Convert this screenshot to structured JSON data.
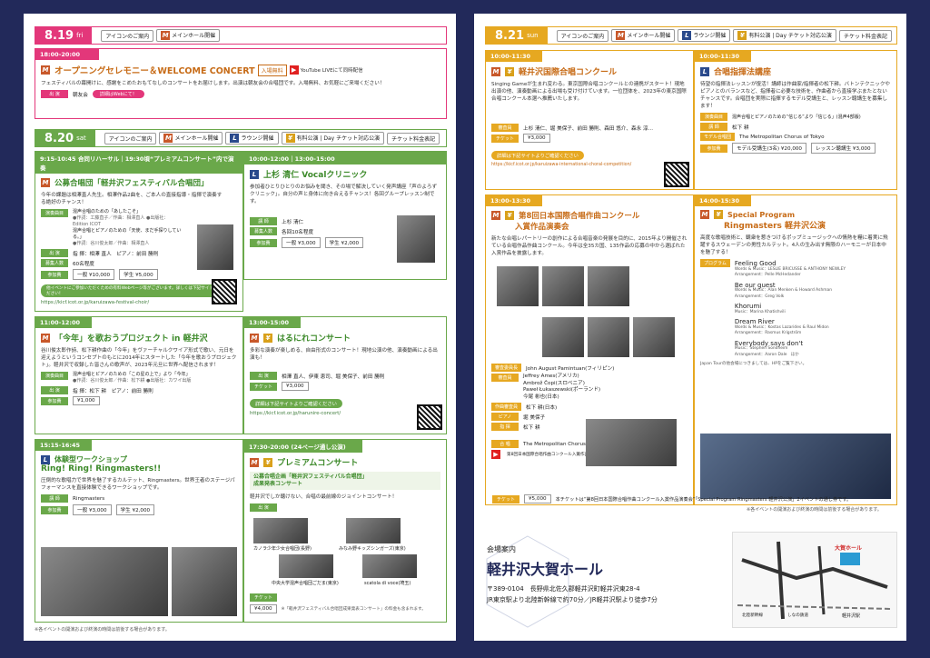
{
  "colors": {
    "pink": "#e3377a",
    "green": "#6aa84a",
    "gold": "#e6a821",
    "navy": "#22295a"
  },
  "legend": {
    "about": "アイコンのご案内",
    "main": "メインホール開催",
    "lounge": "ラウンジ開催",
    "ticket": "有料公演 | Day チケット対応公演",
    "ticketsep": "チケット料金表記"
  },
  "d819": {
    "date": "8.19",
    "dow": "fri",
    "time": "18:00-20:00",
    "title": "オープニングセレモニー＆WELCOME CONCERT",
    "free": "入場無料",
    "yt": "YouTube LIVEにて同時配信",
    "desc": "フェスティバルの幕開けに、感謝をこめたおもてなしのコンサートをお届けします。出演は朝友会の合唱団です。入場無料、お気軽にご来場ください！",
    "perfLabel": "出 演",
    "perf": "朝友会",
    "web": "詳細はWebにて！"
  },
  "d820": {
    "date": "8.20",
    "dow": "sat",
    "c1": {
      "time": "9:15-10:45 合同リハーサル｜19:30頃“プレミアムコンサート”内で演奏",
      "title": "公募合唱団「軽井沢フェスティバル合唱団」",
      "desc": "今年の課題は相澤直人先生。相澤作品2曲を、ご本人の直接指導・指揮で演奏する絶好のチャンス！",
      "songLabel": "演奏曲目",
      "s1": "混声合唱のための「あしたこそ」",
      "s1b": "●作詞：工藤直子／作曲：相澤直人 ●出版社：Edition ICOT",
      "s2": "混声合唱とピアノのための「天使、まだ手探りしている。」",
      "s2b": "●作詞：谷川俊太郎／作曲：相澤直人",
      "condLabel": "出 演",
      "cond": "指 揮：相澤 直人　ピアノ：前田 勝則",
      "capLabel": "募集人数",
      "cap": "60名程度",
      "feeLabel": "参加費",
      "fee1": "一般 ¥10,000",
      "fee2": "学生 ¥5,000",
      "banner": "他イベントにご参加いただくための有料Webページ等がございます。詳しくは下記サイトをご覧ください！",
      "url": "https://kicf.icot.or.jp/karuizawa-festival-choir/"
    },
    "c2": {
      "time": "10:00-12:00｜13:00-15:00",
      "title": "上杉 清仁 Vocalクリニック",
      "desc": "参加者ひとりひとりのお悩みを聞き、その場で解決していく発声講座「声のよろずクリニック」。自分の声と身体に向き合えるチャンス！各回グループレッスン制です。",
      "lecLabel": "講 師",
      "lec": "上杉 清仁",
      "capLabel": "募集人数",
      "cap": "各回10名程度",
      "feeLabel": "参加費",
      "fee1": "一般 ¥3,000",
      "fee2": "学生 ¥2,000"
    },
    "c3": {
      "time": "11:00-12:00",
      "title": "「今年」を歌おうプロジェクト in 軽井沢",
      "desc": "谷川俊太郎作詩、松下耕作曲の「今年」をヴァーチャルクワイア形式で歌い、元日を迎えようというコンセプトのもとに2014年にスタートした「今年を歌おうプロジェクト」。軽井沢で収録した皆さんの歌声が、2023年元旦に世界へ配信されます！",
      "songLabel": "演奏曲目",
      "s1": "混声合唱とピアノのための「この星の上で」より「今年」",
      "s1b": "●作詞：谷川俊太郎／作曲：松下耕 ●出版社：カワイ出版",
      "condLabel": "出 演",
      "cond": "指 揮：松下 耕　ピアノ：前田 勝則",
      "feeLabel": "参加費",
      "fee": "¥1,000"
    },
    "c4": {
      "time": "13:00-15:00",
      "title": "はるにれコンサート",
      "desc": "多彩な演奏が楽しめる、自由形式のコンサート！現地公演の他、演奏動画による出演も！",
      "perfLabel": "出 演",
      "perf": "相澤 直人、伊東 恵司、堀 美保子、前田 勝則",
      "ticketLabel": "チケット",
      "ticket": "¥3,000",
      "banner": "詳細は下記サイトよりご確認ください",
      "url": "https://kicf.icot.or.jp/harunire-concert/"
    },
    "c5": {
      "time": "15:15-16:45",
      "title1": "体験型ワークショップ",
      "title2": "Ring! Ring! Ringmasters!!",
      "desc": "圧倒的な歌唱力で世界を魅了するカルテット、Ringmasters。世界王者のステージパフォーマンスを直接体験できるワークショップです。",
      "lecLabel": "講 師",
      "lec": "Ringmasters",
      "feeLabel": "参加費",
      "fee1": "一般 ¥3,000",
      "fee2": "学生 ¥2,000"
    },
    "c6": {
      "time": "17:30-20:00 (24ページ通し公演)",
      "title": "プレミアムコンサート",
      "sub1": "公募合唱企画「軽井沢フェスティバル合唱団」",
      "sub2": "成果発表コンサート",
      "desc": "軽井沢でしか聴けない、合唱の最前線のジョイントコンサート！",
      "perfLabel": "出 演",
      "p1": "カノラ少年少女合唱団(長野)",
      "p2": "みなみ野キッズシンガーズ(東京)",
      "p3": "中央大学混声合唱団ごだま(東京)",
      "p4": "scatola di voce(埼玉)",
      "ticketLabel": "チケット",
      "ticket": "¥4,000",
      "ticketNote": "※「軽井沢フェスティバル合唱団成果発表コンサート」の料金も含まれます。"
    },
    "footnote": "※各イベントの開演および終演の時間は前後する場合があります。"
  },
  "d821": {
    "date": "8.21",
    "dow": "sun",
    "c1": {
      "time": "10:00-11:30",
      "title": "軽井沢国際合唱コンクール",
      "desc": "Singing Gameが生まれ変わる。東京国際合唱コンクールとの連携がスタート！現地出演の他、演奏動画による出場も受け付けています。一位団体を、2023年の東京国際合唱コンクール本選へ推薦いたします。",
      "judgeLabel": "審査員",
      "judges": "上杉 清仁、堀 美保子、前田 勝則、森田 悠介、森永 淳…",
      "ticketLabel": "チケット",
      "ticket": "¥3,000",
      "banner": "詳細は下記サイトよりご確認ください",
      "url": "https://kicf.icot.or.jp/karuizawa-international-choral-competition/"
    },
    "c2": {
      "time": "10:00-11:30",
      "title": "合唱指揮法講座",
      "desc": "待望の指揮法レッスンが復活！講師は作曲家/指揮者の松下耕。バトンテクニックやピアノとのバランスなど、指揮者に必要な技術を、作曲者から直接学ぶまたとないチャンスです。合唱団を実際に指揮するモデル受講生と、レッスン聴講生を募集します！",
      "songLabel": "演奏曲目",
      "song": "混声合唱とピアノのための“信じる”より「信じる」(混声4部版)",
      "lecLabel": "講 師",
      "lec": "松下 耕",
      "choirLabel": "モデル合唱団",
      "choir": "The Metropolitan Chorus of Tokyo",
      "feeLabel": "参加費",
      "fee1": "モデル受講生(3名) ¥20,000",
      "fee2": "レッスン聴講生 ¥3,000"
    },
    "c3": {
      "time": "13:00-13:30",
      "title1": "第8回日本国際合唱作曲コンクール",
      "title2": "入賞作品演奏会",
      "desc": "新たな合唱レパートリーの創作による合唱音楽の発展を目的に、2015年より開催されている合唱作品作曲コンクール。今年は全35カ国、135作品の応募の中から選ばれた入賞作品を披露します。",
      "judgeLabel": "審査委員長",
      "judgeHead": "John August Pamintuan(フィリピン)",
      "judgesLabel": "審査員",
      "j1": "Jeffrey Ames(アメリカ)",
      "j2": "Ambrož Čopi(スロベニア)",
      "j3": "Paweł Łukaszewski(ポーランド)",
      "j4": "今尾 彬也(日本)",
      "judge2Label": "作曲審査員",
      "j5": "松下 耕(日本)",
      "pianoLabel": "ピアノ",
      "piano": "堀 美保子",
      "condLabel": "指 揮",
      "cond": "松下 耕",
      "choirLabel": "合 唱",
      "choir": "The Metropolitan Chorus of Tokyo",
      "yt": "第8回日本国際合唱作曲コンクール入賞作品演奏会のみ YouTube LIVEにて同時配信",
      "ticketLabel": "チケット",
      "ticket": "¥5,000",
      "ticketNote": "本チケットは“第8回日本国際合唱作曲コンクール入賞作品演奏会”「Special Program Ringmasters 軽井沢公演」2イベントの通し券です。"
    },
    "c4": {
      "time": "14:00-15:30",
      "title1": "Special Program",
      "title2": "Ringmasters 軽井沢公演",
      "desc": "高度な歌唱技術と、観衆を惹きつけるポップミュージックへの情熱を糧に着実に飛躍するスウェーデンの男性カルテット。4人の生み出す無限のハーモニーが日本中を魅了する！",
      "progLabel": "プログラム",
      "songs": [
        {
          "title": "Feeling Good",
          "credit": "Words & Music：LESLIE BRICUSSE & ANTHONY NEWLEY",
          "arr": "Arrangement：Pelle McHedander"
        },
        {
          "title": "Be our guest",
          "credit": "Words & Music：Alan Menken & Howard Ashman",
          "arr": "Arrangement：Greg Volk"
        },
        {
          "title": "Khorumi",
          "credit": "Music：Marina Khatishvili",
          "arr": ""
        },
        {
          "title": "Dream River",
          "credit": "Words & Music：Kostas Lazarides & Raul Midon",
          "arr": "Arrangement：Rasmus Krigström"
        },
        {
          "title": "Everybody says don't",
          "credit": "Music：Stephen Sondheim",
          "arr": "Arrangement：Aaron Dale"
        }
      ],
      "others": "ほか",
      "note": "Japan Tourの他会場につきましては、HPをご覧下さい。"
    },
    "footnote": "※各イベントの開演および終演の時間は前後する場合があります。"
  },
  "venue": {
    "guide": "会場案内",
    "name": "軽井沢大賀ホール",
    "addr": "〒389-0104　長野県北佐久郡軽井沢町軽井沢東28-4",
    "access": "JR東京駅より北陸新幹線で約70分／JR軽井沢駅より徒歩7分",
    "map": {
      "hall": "大賀ホール",
      "station": "軽井沢駅",
      "st2": "北陸新幹線",
      "st3": "しなの鉄道"
    }
  }
}
